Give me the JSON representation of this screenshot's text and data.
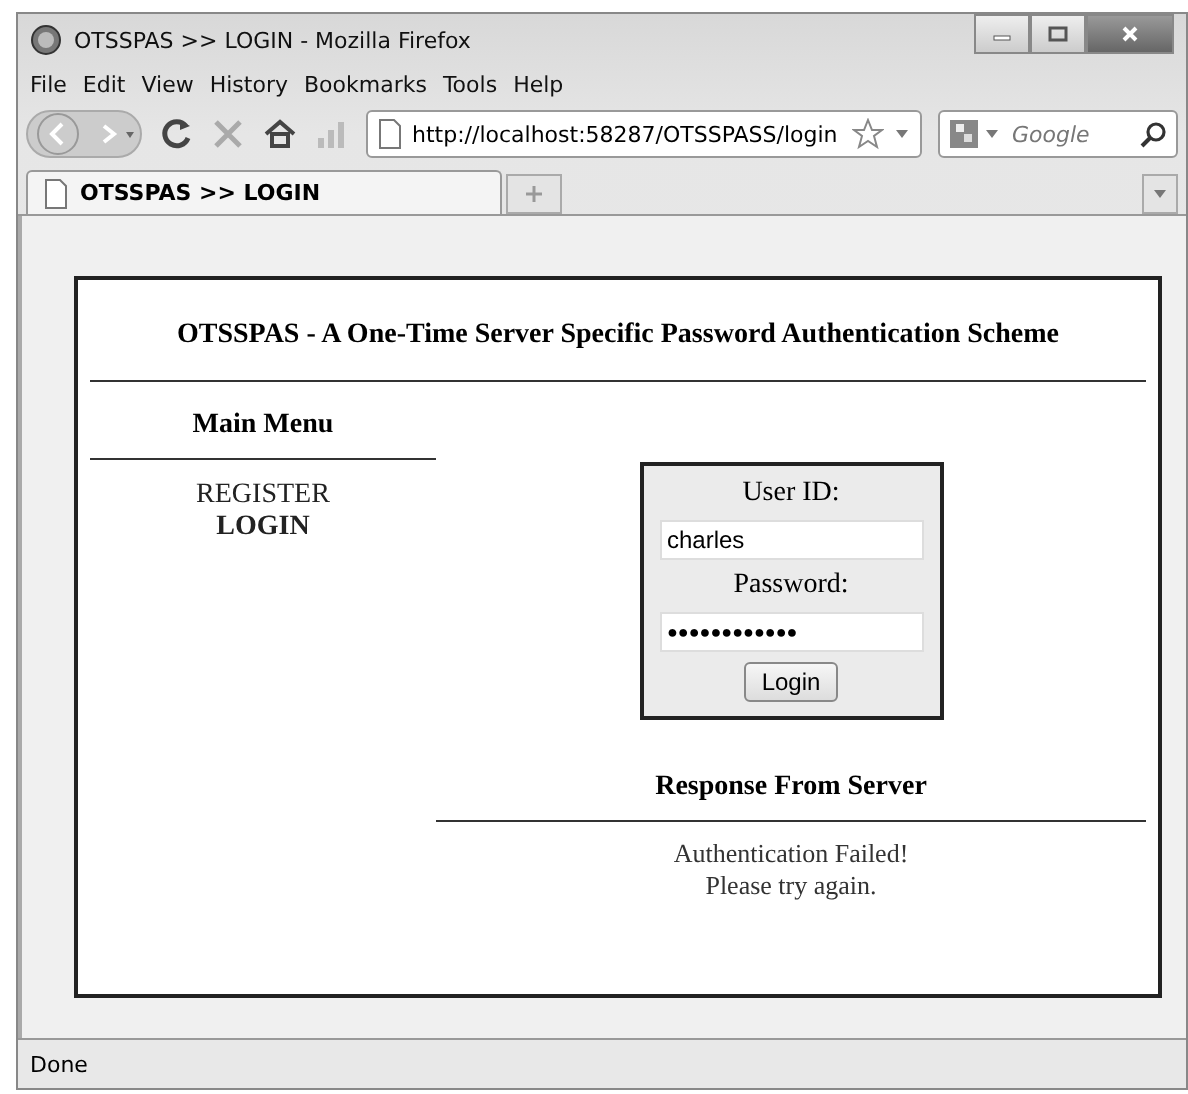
{
  "window": {
    "title": "OTSSPAS >> LOGIN - Mozilla Firefox"
  },
  "menu_bar": [
    "File",
    "Edit",
    "View",
    "History",
    "Bookmarks",
    "Tools",
    "Help"
  ],
  "address_bar": {
    "value": "http://localhost:58287/OTSSPASS/login"
  },
  "search": {
    "placeholder": "Google"
  },
  "tabs": [
    {
      "label": "OTSSPAS >> LOGIN",
      "selected": true
    }
  ],
  "page": {
    "heading": "OTSSPAS - A One-Time Server Specific Password Authentication Scheme",
    "menu_title": "Main Menu",
    "menu_items": [
      {
        "label": "REGISTER",
        "selected": false
      },
      {
        "label": "LOGIN",
        "selected": true
      }
    ],
    "form": {
      "user_label": "User ID:",
      "user_value": "charles",
      "password_label": "Password:",
      "password_value": "●●●●●●●●●●●●",
      "button": "Login"
    },
    "response_title": "Response From Server",
    "response_lines": [
      "Authentication Failed!",
      "Please try again."
    ]
  },
  "status_bar": "Done"
}
